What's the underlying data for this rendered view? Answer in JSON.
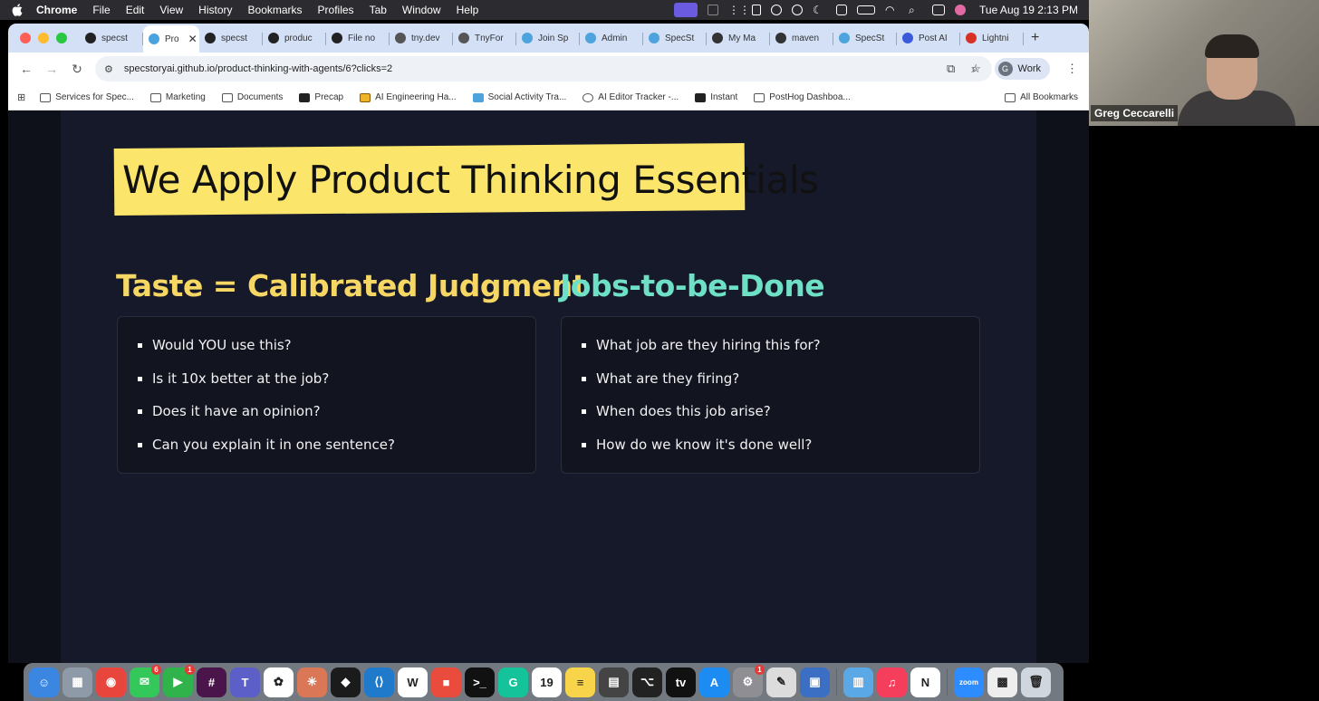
{
  "menubar": {
    "app": "Chrome",
    "items": [
      "File",
      "Edit",
      "View",
      "History",
      "Bookmarks",
      "Profiles",
      "Tab",
      "Window",
      "Help"
    ],
    "clock": "Tue Aug 19  2:13 PM"
  },
  "tabs": [
    {
      "label": "specst",
      "color": "#222222"
    },
    {
      "label": "Pro",
      "color": "#4aa3df",
      "active": true
    },
    {
      "label": "specst",
      "color": "#222222"
    },
    {
      "label": "produc",
      "color": "#222222"
    },
    {
      "label": "File no",
      "color": "#222222"
    },
    {
      "label": "tny.dev",
      "color": "#555555"
    },
    {
      "label": "TnyFor",
      "color": "#555555"
    },
    {
      "label": "Join Sp",
      "color": "#4ca3dd"
    },
    {
      "label": "Admin",
      "color": "#4ca3dd"
    },
    {
      "label": "SpecSt",
      "color": "#4ca3dd"
    },
    {
      "label": "My Ma",
      "color": "#333333"
    },
    {
      "label": "maven",
      "color": "#333333"
    },
    {
      "label": "SpecSt",
      "color": "#4ca3dd"
    },
    {
      "label": "Post AI",
      "color": "#3b5bdb"
    },
    {
      "label": "Lightni",
      "color": "#d93025"
    }
  ],
  "omnibox": {
    "url": "specstoryai.github.io/product-thinking-with-agents/6?clicks=2"
  },
  "profile": {
    "initial": "G",
    "label": "Work"
  },
  "bookmarks": [
    {
      "label": "Services for Spec...",
      "icon": "folder"
    },
    {
      "label": "Marketing",
      "icon": "folder"
    },
    {
      "label": "Documents",
      "icon": "folder"
    },
    {
      "label": "Precap",
      "icon": "square"
    },
    {
      "label": "AI Engineering Ha...",
      "icon": "amber"
    },
    {
      "label": "Social Activity Tra...",
      "icon": "color"
    },
    {
      "label": "AI Editor Tracker -...",
      "icon": "circle"
    },
    {
      "label": "Instant",
      "icon": "square"
    },
    {
      "label": "PostHog Dashboa...",
      "icon": "folder"
    }
  ],
  "all_bookmarks": "All Bookmarks",
  "slide": {
    "headline": "We Apply Product Thinking Essentials",
    "left": {
      "title": "Taste = Calibrated Judgment",
      "items": [
        "Would YOU use this?",
        "Is it 10x better at the job?",
        "Does it have an opinion?",
        "Can you explain it in one sentence?"
      ]
    },
    "right": {
      "title": "Jobs-to-be-Done",
      "items": [
        "What job are they hiring this for?",
        "What are they firing?",
        "When does this job arise?",
        "How do we know it's done well?"
      ]
    }
  },
  "video": {
    "name": "Greg Ceccarelli"
  },
  "dock": [
    {
      "name": "finder-icon",
      "color": "#3a86e0",
      "glyph": "☺"
    },
    {
      "name": "launchpad-icon",
      "color": "#8e9aa8",
      "glyph": "▦"
    },
    {
      "name": "chrome-icon",
      "color": "#e8453c",
      "glyph": "◉"
    },
    {
      "name": "messages-icon",
      "color": "#34c759",
      "glyph": "✉",
      "badge": "6"
    },
    {
      "name": "facetime-icon",
      "color": "#2fb34a",
      "glyph": "▶",
      "badge": "1"
    },
    {
      "name": "slack-icon",
      "color": "#4a154b",
      "glyph": "#"
    },
    {
      "name": "teams-icon",
      "color": "#5b5fc7",
      "glyph": "T"
    },
    {
      "name": "chatgpt-icon",
      "color": "#ffffff",
      "glyph": "✿"
    },
    {
      "name": "claude-icon",
      "color": "#d97757",
      "glyph": "✳"
    },
    {
      "name": "cursor-icon",
      "color": "#1b1b1b",
      "glyph": "◆"
    },
    {
      "name": "vscode-icon",
      "color": "#1f7acb",
      "glyph": "⟨⟩"
    },
    {
      "name": "windsurf-icon",
      "color": "#ffffff",
      "glyph": "W"
    },
    {
      "name": "notes-red-icon",
      "color": "#e94b3c",
      "glyph": "■"
    },
    {
      "name": "terminal-icon",
      "color": "#111111",
      "glyph": ">_"
    },
    {
      "name": "grammarly-icon",
      "color": "#15c39a",
      "glyph": "G"
    },
    {
      "name": "calendar-icon",
      "color": "#ffffff",
      "glyph": "19"
    },
    {
      "name": "notes-icon",
      "color": "#f7d44a",
      "glyph": "≡"
    },
    {
      "name": "screen-icon",
      "color": "#444444",
      "glyph": "▤"
    },
    {
      "name": "tower-icon",
      "color": "#222222",
      "glyph": "⌥"
    },
    {
      "name": "appletv-icon",
      "color": "#111111",
      "glyph": "tv"
    },
    {
      "name": "appstore-icon",
      "color": "#1c8cf2",
      "glyph": "A"
    },
    {
      "name": "settings-icon",
      "color": "#8e8e93",
      "glyph": "⚙",
      "badge": "1"
    },
    {
      "name": "pencil-icon",
      "color": "#dcdcdc",
      "glyph": "✎"
    },
    {
      "name": "preview-icon",
      "color": "#3a6fc4",
      "glyph": "▣"
    },
    {
      "name": "books-icon",
      "color": "#5aa8e6",
      "glyph": "▥"
    },
    {
      "name": "music-icon",
      "color": "#f43e5c",
      "glyph": "♫"
    },
    {
      "name": "notion-icon",
      "color": "#ffffff",
      "glyph": "N"
    },
    {
      "name": "zoom-icon",
      "color": "#2d8cff",
      "glyph": "zoom"
    },
    {
      "name": "qr-icon",
      "color": "#eeeeee",
      "glyph": "▩"
    },
    {
      "name": "trash-icon",
      "color": "#cfd6dd",
      "glyph": "🗑"
    }
  ]
}
